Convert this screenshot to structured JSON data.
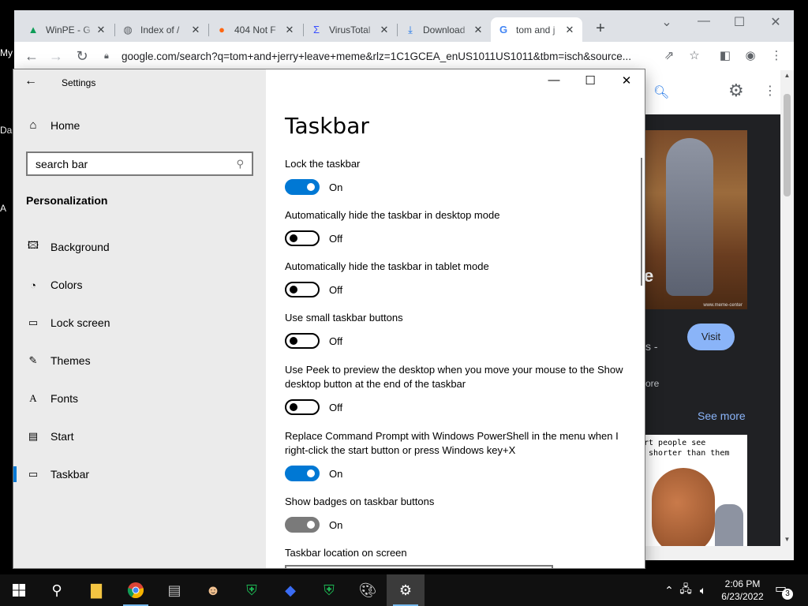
{
  "desktop": {
    "labels": [
      "My",
      "Da",
      "A"
    ]
  },
  "browser": {
    "tabs": [
      {
        "title": "WinPE - G",
        "favicon": "google-drive-icon",
        "favicon_color": "#0f9d58"
      },
      {
        "title": "Index of /",
        "favicon": "globe-icon",
        "favicon_color": "#5f6368"
      },
      {
        "title": "404 Not F",
        "favicon": "firefox-icon",
        "favicon_color": "#ff6611"
      },
      {
        "title": "VirusTotal",
        "favicon": "virustotal-icon",
        "favicon_color": "#394eff"
      },
      {
        "title": "Download",
        "favicon": "download-icon",
        "favicon_color": "#1a73e8"
      },
      {
        "title": "tom and j",
        "favicon": "google-icon",
        "favicon_color": "#4285f4"
      }
    ],
    "new_tab_label": "+",
    "url": "google.com/search?q=tom+and+jerry+leave+meme&rlz=1C1GCEA_enUS1011US1011&tbm=isch&source...",
    "page": {
      "visit_label": "Visit",
      "see_more_label": "See more",
      "snippet_dash": "s -",
      "snippet_more": "ore",
      "meme_caption": "rt people see\n shorter than them",
      "image_watermark": "www.meme-center",
      "image_letter": "e"
    }
  },
  "settings": {
    "window_title": "Settings",
    "home_label": "Home",
    "search_value": "search bar",
    "section_heading": "Personalization",
    "nav_items": [
      {
        "label": "Background",
        "icon": "image-icon"
      },
      {
        "label": "Colors",
        "icon": "palette-icon"
      },
      {
        "label": "Lock screen",
        "icon": "lock-screen-icon"
      },
      {
        "label": "Themes",
        "icon": "brush-icon"
      },
      {
        "label": "Fonts",
        "icon": "font-icon"
      },
      {
        "label": "Start",
        "icon": "start-icon"
      },
      {
        "label": "Taskbar",
        "icon": "taskbar-icon",
        "selected": true
      }
    ],
    "page_title": "Taskbar",
    "options": [
      {
        "label": "Lock the taskbar",
        "state": "On",
        "on": true
      },
      {
        "label": "Automatically hide the taskbar in desktop mode",
        "state": "Off",
        "on": false
      },
      {
        "label": "Automatically hide the taskbar in tablet mode",
        "state": "Off",
        "on": false
      },
      {
        "label": "Use small taskbar buttons",
        "state": "Off",
        "on": false
      },
      {
        "label": "Use Peek to preview the desktop when you move your mouse to the Show desktop button at the end of the taskbar",
        "state": "Off",
        "on": false
      },
      {
        "label": "Replace Command Prompt with Windows PowerShell in the menu when I right-click the start button or press Windows key+X",
        "state": "On",
        "on": true
      },
      {
        "label": "Show badges on taskbar buttons",
        "state": "On",
        "on": true,
        "disabled": true
      }
    ],
    "location_label": "Taskbar location on screen"
  },
  "taskbar": {
    "apps": [
      "start-icon",
      "search-icon",
      "file-explorer-icon",
      "chrome-icon",
      "drive-tool-icon",
      "user-tool-icon",
      "shield-check-icon",
      "cube-icon",
      "shield-check-icon",
      "paint-icon",
      "settings-gear-icon"
    ],
    "time": "2:06 PM",
    "date": "6/23/2022",
    "notification_count": "3",
    "accent_color": "#0078d4"
  }
}
